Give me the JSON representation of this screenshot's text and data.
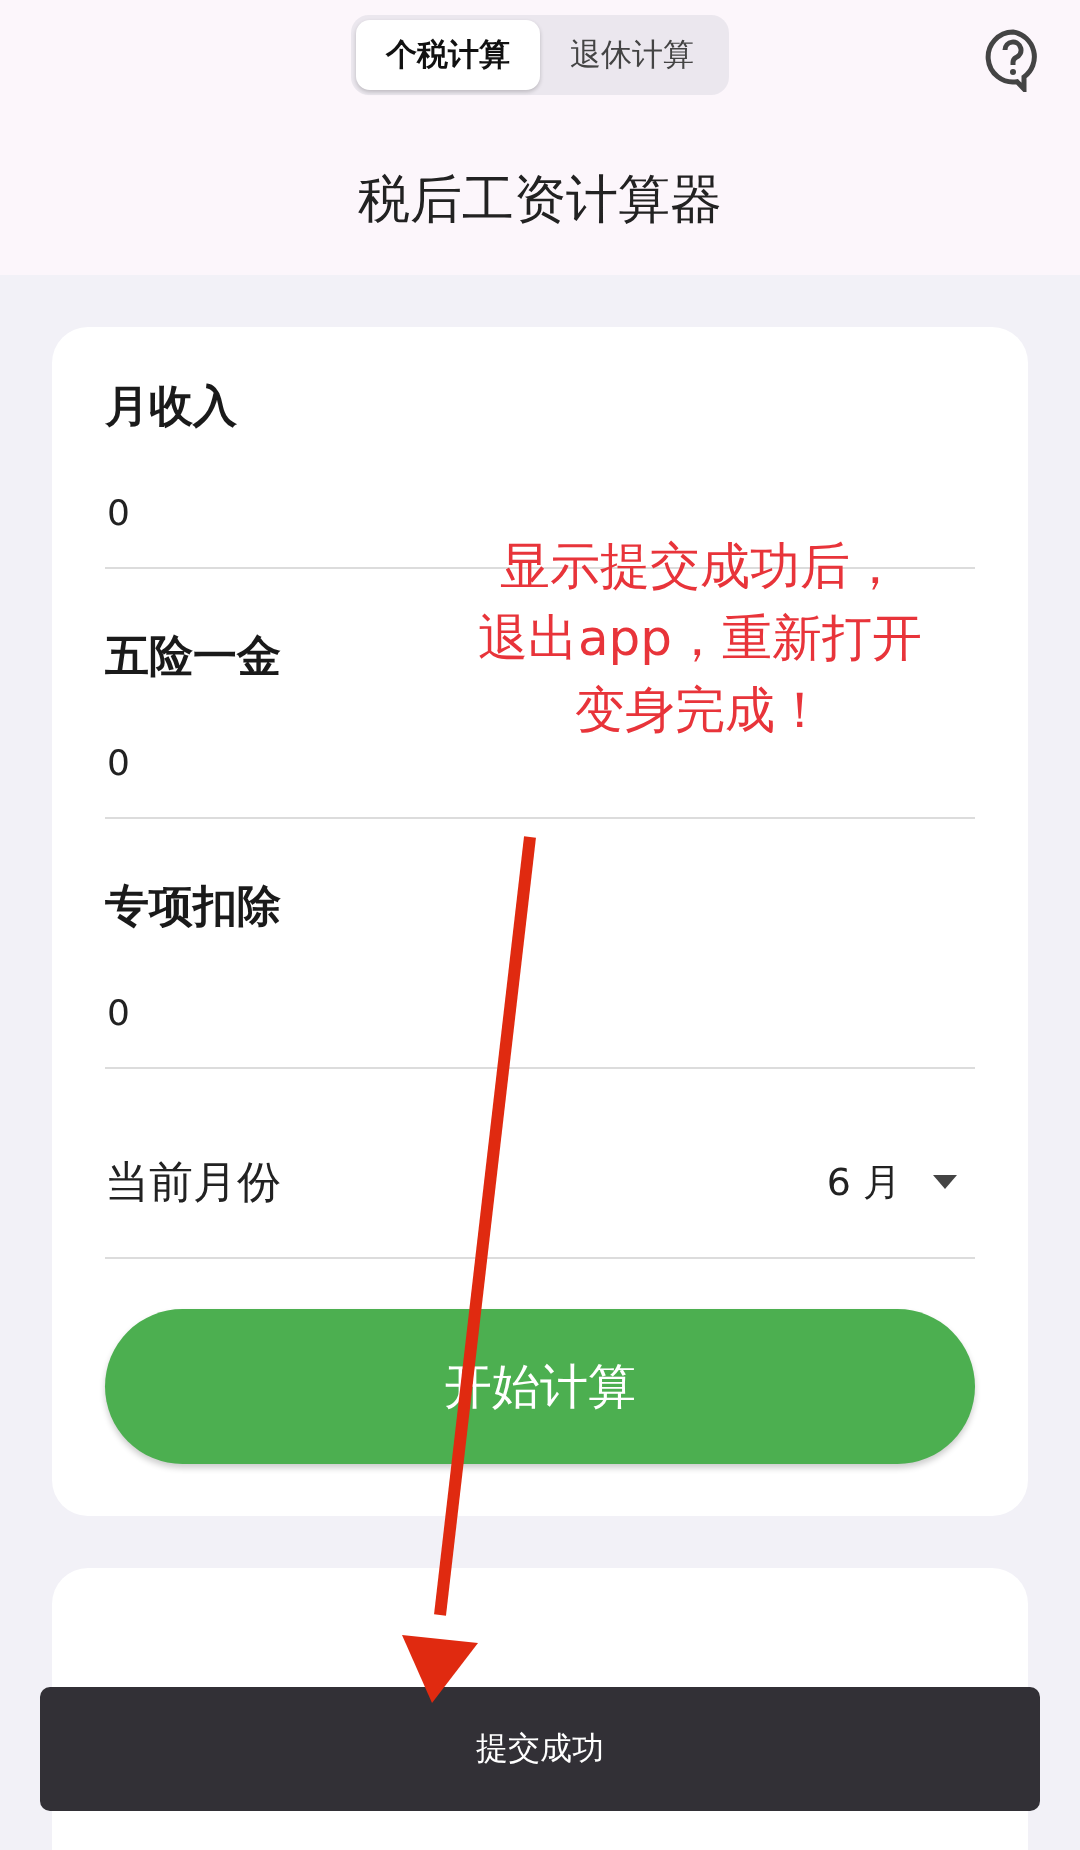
{
  "tabs": [
    {
      "label": "个税计算",
      "selected": true
    },
    {
      "label": "退休计算",
      "selected": false
    }
  ],
  "title": "税后工资计算器",
  "fields": [
    {
      "label": "月收入",
      "value": "0"
    },
    {
      "label": "五险一金",
      "value": "0"
    },
    {
      "label": "专项扣除",
      "value": "0"
    }
  ],
  "month": {
    "label": "当前月份",
    "value": "6 月"
  },
  "calculate_button": "开始计算",
  "toast": "提交成功",
  "annotation": {
    "lines": [
      "显示提交成功后，",
      "退出app，重新打开",
      "变身完成！"
    ]
  }
}
